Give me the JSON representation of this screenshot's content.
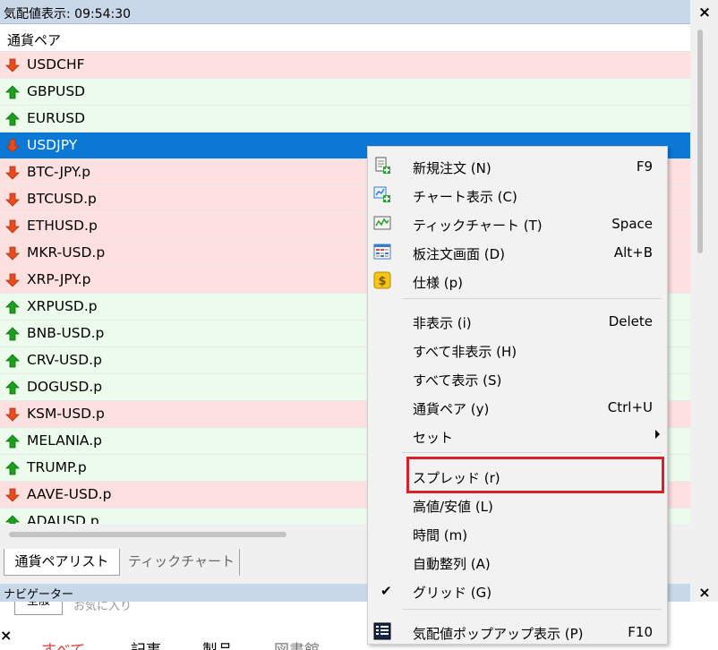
{
  "window": {
    "title": "気配値表示: 09:54:30"
  },
  "list": {
    "header": "通貨ペア",
    "rows": [
      {
        "symbol": "USDCHF",
        "dir": "down"
      },
      {
        "symbol": "GBPUSD",
        "dir": "up"
      },
      {
        "symbol": "EURUSD",
        "dir": "up"
      },
      {
        "symbol": "USDJPY",
        "dir": "down",
        "selected": true
      },
      {
        "symbol": "BTC-JPY.p",
        "dir": "down"
      },
      {
        "symbol": "BTCUSD.p",
        "dir": "down"
      },
      {
        "symbol": "ETHUSD.p",
        "dir": "down"
      },
      {
        "symbol": "MKR-USD.p",
        "dir": "down"
      },
      {
        "symbol": "XRP-JPY.p",
        "dir": "down"
      },
      {
        "symbol": "XRPUSD.p",
        "dir": "up"
      },
      {
        "symbol": "BNB-USD.p",
        "dir": "up"
      },
      {
        "symbol": "CRV-USD.p",
        "dir": "up"
      },
      {
        "symbol": "DOGUSD.p",
        "dir": "up"
      },
      {
        "symbol": "KSM-USD.p",
        "dir": "down"
      },
      {
        "symbol": "MELANIA.p",
        "dir": "up"
      },
      {
        "symbol": "TRUMP.p",
        "dir": "up"
      },
      {
        "symbol": "AAVE-USD.p",
        "dir": "down"
      },
      {
        "symbol": "ADAUSD.p",
        "dir": "up"
      }
    ]
  },
  "tabs": [
    "通貨ペアリスト",
    "ティックチャート"
  ],
  "navigator": {
    "title": "ナビゲーター",
    "tabs": [
      "全般",
      "お気に入り"
    ],
    "bottom_items": [
      "すべて",
      "記事",
      "製品",
      "図書館"
    ]
  },
  "context_menu": {
    "items": [
      {
        "label": "新規注文 (N)",
        "shortcut": "F9",
        "icon": "new-order-icon"
      },
      {
        "label": "チャート表示 (C)",
        "shortcut": "",
        "icon": "chart-window-icon"
      },
      {
        "label": "ティックチャート (T)",
        "shortcut": "Space",
        "icon": "tick-chart-icon"
      },
      {
        "label": "板注文画面 (D)",
        "shortcut": "Alt+B",
        "icon": "depth-of-market-icon"
      },
      {
        "label": "仕様 (p)",
        "shortcut": "",
        "icon": "dollar-icon"
      },
      {
        "label": "非表示 (i)",
        "shortcut": "Delete"
      },
      {
        "label": "すべて非表示 (H)",
        "shortcut": ""
      },
      {
        "label": "すべて表示 (S)",
        "shortcut": ""
      },
      {
        "label": "通貨ペア (y)",
        "shortcut": "Ctrl+U"
      },
      {
        "label": "セット",
        "shortcut": "",
        "submenu": true
      },
      {
        "label": "スプレッド (r)",
        "shortcut": "",
        "highlighted": true
      },
      {
        "label": "高値/安値 (L)",
        "shortcut": ""
      },
      {
        "label": "時間 (m)",
        "shortcut": ""
      },
      {
        "label": "自動整列 (A)",
        "shortcut": ""
      },
      {
        "label": "グリッド (G)",
        "shortcut": "",
        "checked": true
      },
      {
        "label": "気配値ポップアップ表示 (P)",
        "shortcut": "F10",
        "icon": "popup-prices-icon"
      }
    ]
  },
  "colors": {
    "up_row": "#ecfbec",
    "down_row": "#ffe0e0",
    "selected": "#0a78d4",
    "up_arrow": "#1aa01a",
    "down_arrow": "#e84c1c",
    "highlight_border": "#d9202a"
  }
}
